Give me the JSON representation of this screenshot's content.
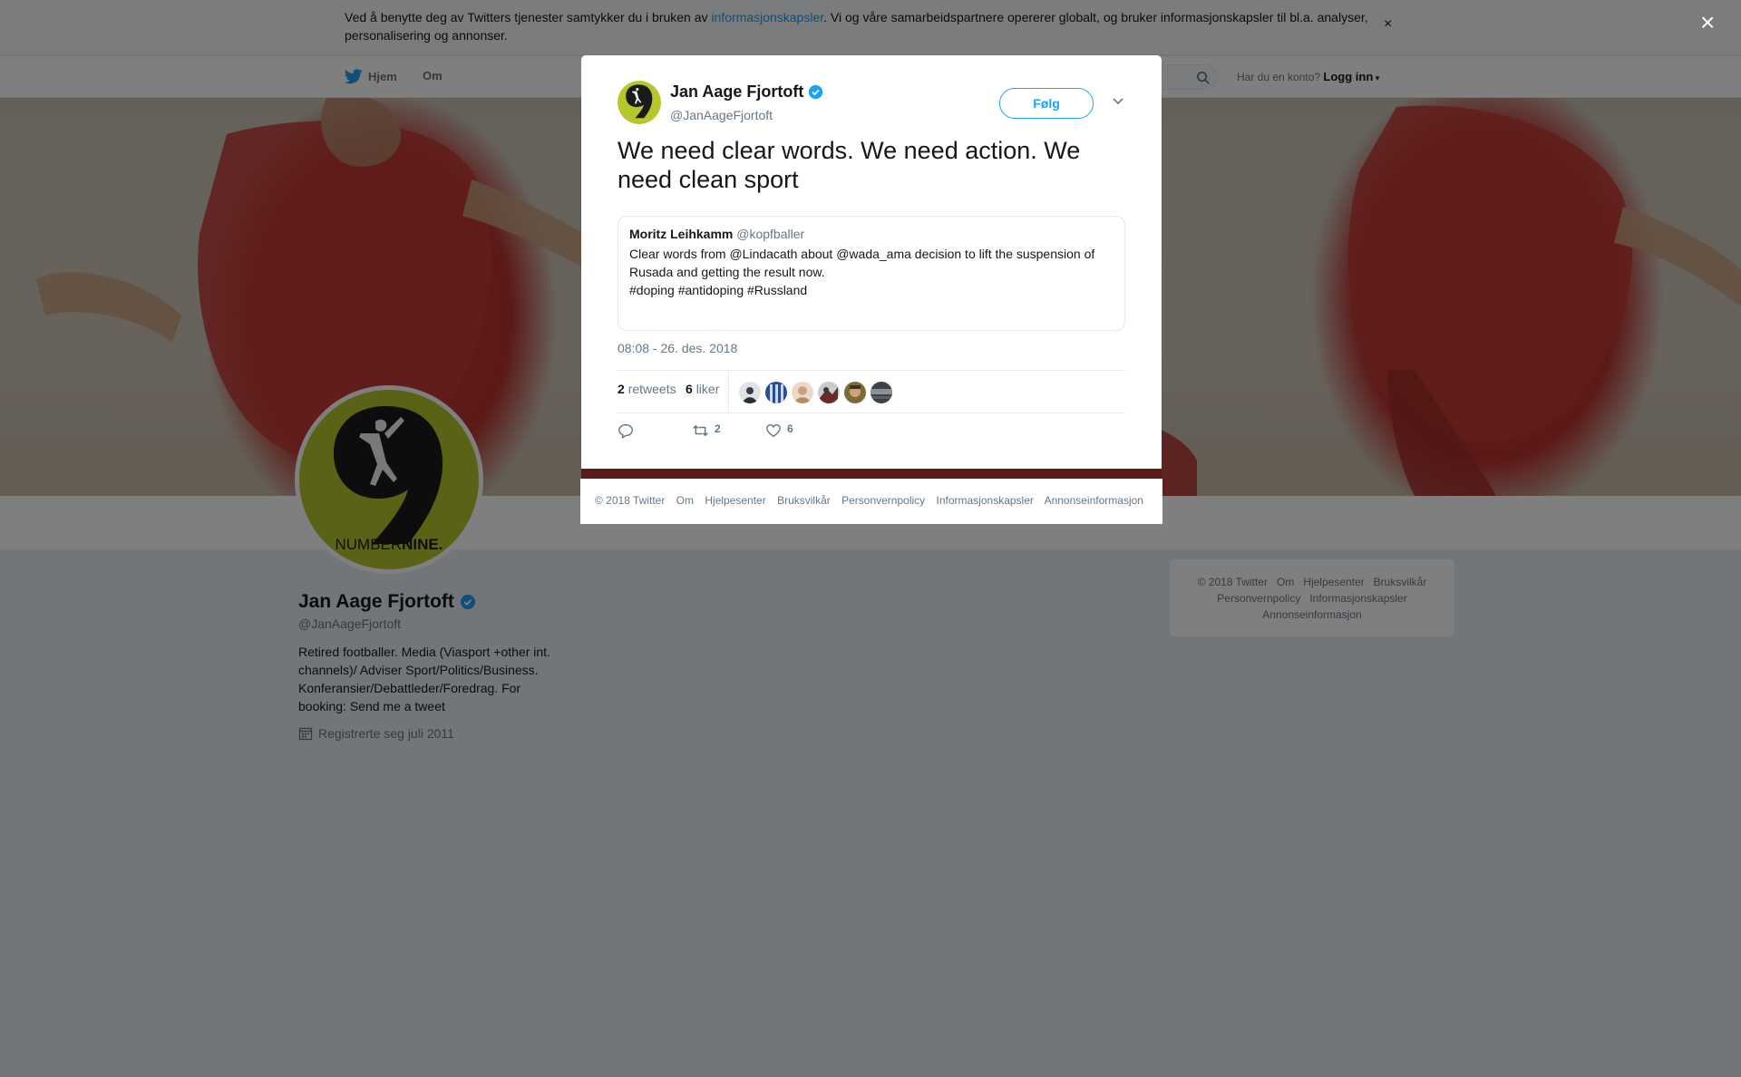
{
  "cookie_banner": {
    "text_before": "Ved å benytte deg av Twitters tjenester samtykker du i bruken av ",
    "link": "informasjonskapsler",
    "text_after": ". Vi og våre samarbeidspartnere opererer globalt, og bruker informasjonskapsler til bl.a. analyser, personalisering og annonser.",
    "close": "×"
  },
  "nav": {
    "home": "Hjem",
    "about": "Om",
    "login_prompt": "Har du en konto?",
    "login": "Logg inn"
  },
  "profile": {
    "name": "Jan Aage Fjortoft",
    "handle": "@JanAageFjortoft",
    "bio": "Retired footballer. Media (Viasport +other int. channels)/ Adviser Sport/Politics/Business. Konferansier/Debattleder/Foredrag. For booking: Send me a tweet",
    "joined": "Registrerte seg juli 2011",
    "logo_text_a": "NUMBER",
    "logo_text_b": "NINE."
  },
  "side_footer": {
    "items": [
      "© 2018 Twitter",
      "Om",
      "Hjelpesenter",
      "Bruksvilkår",
      "Personvernpolicy",
      "Informasjonskapsler",
      "Annonseinformasjon"
    ]
  },
  "modal": {
    "author_name": "Jan Aage Fjortoft",
    "author_handle": "@JanAageFjortoft",
    "follow": "Følg",
    "tweet_text": "We need clear words. We need action. We need clean sport",
    "quote": {
      "name": "Moritz Leihkamm",
      "handle": "@kopfballer",
      "text": "Clear words from @Lindacath about @wada_ama decision to lift the suspension of Rusada and getting the result now.\n#doping #antidoping #Russland"
    },
    "timestamp": "08:08 - 26. des. 2018",
    "retweets_count": "2",
    "retweets_label": "retweets",
    "likes_count": "6",
    "likes_label": "liker",
    "action_retweet_count": "2",
    "action_like_count": "6"
  },
  "modal_footer": {
    "items": [
      "© 2018 Twitter",
      "Om",
      "Hjelpesenter",
      "Bruksvilkår",
      "Personvernpolicy",
      "Informasjonskapsler",
      "Annonseinformasjon"
    ]
  },
  "overlay_close": "×",
  "colors": {
    "twitter_blue": "#1da1f2",
    "logo_green": "#b5c72a",
    "logo_black": "#1a1a1a"
  }
}
